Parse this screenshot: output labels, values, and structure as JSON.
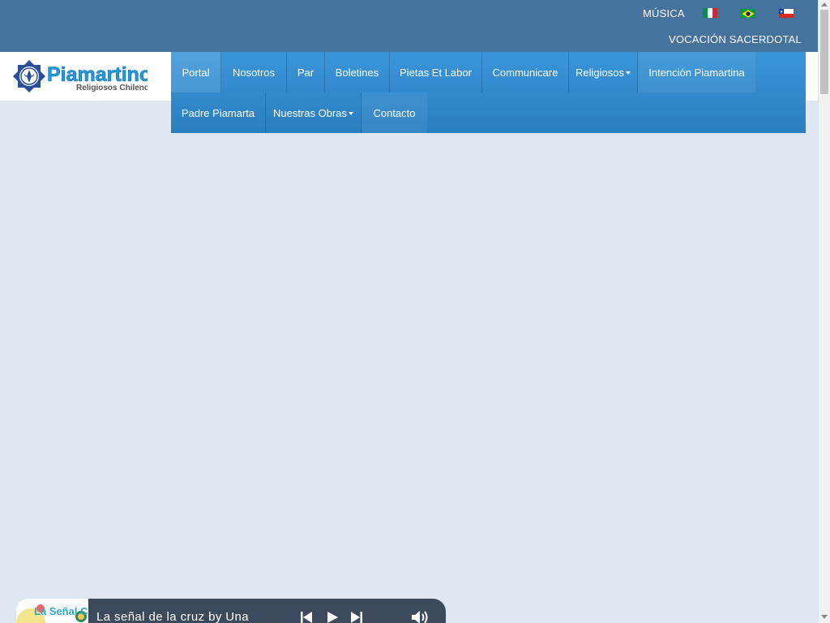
{
  "topbar": {
    "musica": "MÚSICA",
    "vocacion": "VOCACIÓN SACERDOTAL",
    "flags": [
      "italian-flag-icon",
      "brazil-flag-icon",
      "chile-flag-icon"
    ]
  },
  "logo": {
    "name": "Piamartinos",
    "subtitle": "Religiosos Chilenos"
  },
  "nav": {
    "items": [
      {
        "label": "Portal"
      },
      {
        "label": "Nosotros"
      },
      {
        "label": "Par"
      },
      {
        "label": "Boletines"
      },
      {
        "label": "Pietas Et Labor"
      },
      {
        "label": "Communicare"
      },
      {
        "label": "Religiosos"
      },
      {
        "label": "Intención Piamartina"
      },
      {
        "label": "Padre Piamarta"
      },
      {
        "label": "Nuestras Obras"
      },
      {
        "label": "Contacto"
      }
    ]
  },
  "player": {
    "track": "La señal de la cruz by Una",
    "album_art_text": "La Señal Cruz",
    "controls": [
      "previous-icon",
      "play-icon",
      "next-icon",
      "volume-icon"
    ]
  },
  "colors": {
    "topbar": "#46729e",
    "nav": "#3a95d9",
    "background": "#dfe8f1",
    "player": "#3b4a5c"
  }
}
